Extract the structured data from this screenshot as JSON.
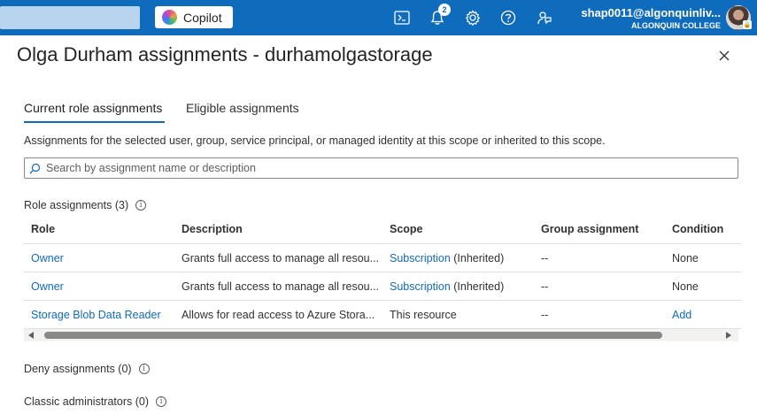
{
  "topbar": {
    "copilot_label": "Copilot",
    "notification_count": "2",
    "user_name": "shap0011@algonquinliv...",
    "user_org": "ALGONQUIN COLLEGE"
  },
  "panel": {
    "title": "Olga Durham assignments - durhamolgastorage",
    "tabs": [
      {
        "label": "Current role assignments",
        "active": true
      },
      {
        "label": "Eligible assignments",
        "active": false
      }
    ],
    "description": "Assignments for the selected user, group, service principal, or managed identity at this scope or inherited to this scope.",
    "search_placeholder": "Search by assignment name or description"
  },
  "role_assignments": {
    "label": "Role assignments (3)",
    "columns": [
      "Role",
      "Description",
      "Scope",
      "Group assignment",
      "Condition"
    ],
    "rows": [
      {
        "role": "Owner",
        "description": "Grants full access to manage all resou...",
        "scope_link": "Subscription",
        "scope_suffix": " (Inherited)",
        "group": "--",
        "condition": "None"
      },
      {
        "role": "Owner",
        "description": "Grants full access to manage all resou...",
        "scope_link": "Subscription",
        "scope_suffix": " (Inherited)",
        "group": "--",
        "condition": "None"
      },
      {
        "role": "Storage Blob Data Reader",
        "description": "Allows for read access to Azure Stora...",
        "scope_text": "This resource",
        "group": "--",
        "condition": "Add"
      }
    ]
  },
  "deny_label": "Deny assignments (0)",
  "classic_label": "Classic administrators (0)",
  "colors": {
    "accent": "#0f6cbd",
    "topbar": "#0f6cbd"
  }
}
